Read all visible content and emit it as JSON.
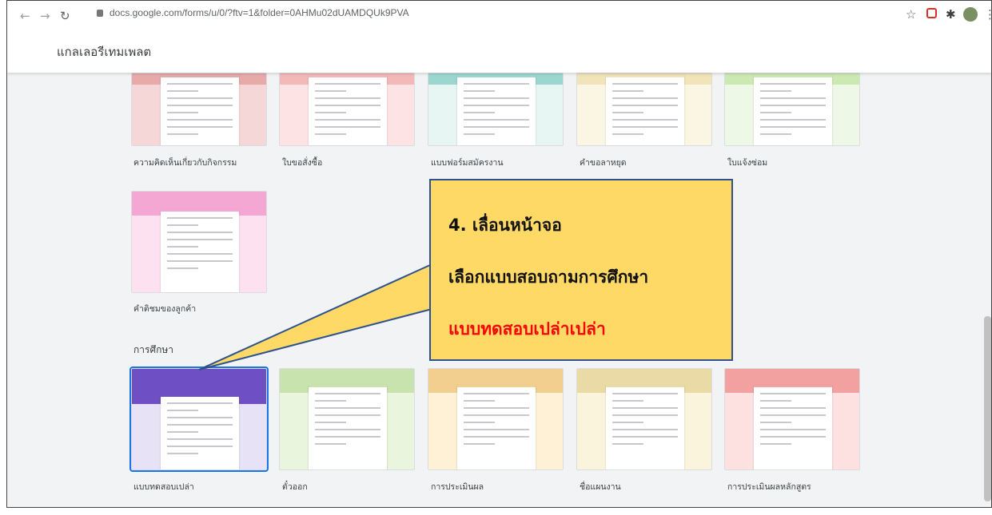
{
  "browser": {
    "url": "docs.google.com/forms/u/0/?ftv=1&folder=0AHMu02dUAMDQUk9PVA"
  },
  "header": {
    "title": "แกลเลอรีเทมเพลต"
  },
  "templates_top": [
    {
      "label": "ความคิดเห็นเกี่ยวกับกิจกรรม",
      "colors": [
        "#e8a9a9",
        "#f6d7d7"
      ]
    },
    {
      "label": "ใบขอสั่งซื้อ",
      "colors": [
        "#f3b9b9",
        "#fde3e3"
      ]
    },
    {
      "label": "แบบฟอร์มสมัครงาน",
      "colors": [
        "#9bd7cf",
        "#e7f6f3"
      ]
    },
    {
      "label": "คำขอลาหยุด",
      "colors": [
        "#f0e4b8",
        "#fbf6e3"
      ]
    },
    {
      "label": "ใบแจ้งซ่อม",
      "colors": [
        "#cce9b3",
        "#eef8e6"
      ]
    }
  ],
  "templates_middle": [
    {
      "label": "คำติชมของลูกค้า",
      "colors": [
        "#f5a7d3",
        "#fde1f0"
      ]
    }
  ],
  "education_section": {
    "title": "การศึกษา",
    "templates": [
      {
        "label": "แบบทดสอบเปล่า",
        "colors": [
          "#6f4fc4",
          "#e8e2f7"
        ]
      },
      {
        "label": "ตั๋วออก",
        "colors": [
          "#c8e3ad",
          "#e9f5dd"
        ]
      },
      {
        "label": "การประเมินผล",
        "colors": [
          "#f2cf8e",
          "#fff1d6"
        ]
      },
      {
        "label": "ชื่อแผนงาน",
        "colors": [
          "#eadba6",
          "#fbf4dc"
        ]
      },
      {
        "label": "การประเมินผลหลักสูตร",
        "colors": [
          "#f3a0a0",
          "#fde0e0"
        ]
      }
    ]
  },
  "callout": {
    "line1": "4. เลื่อนหน้าจอ",
    "line2": "เลือกแบบสอบถามการศึกษา",
    "line3": "แบบทดสอบเปล่าเปล่า",
    "fill_color": "#ffd966",
    "border_color": "#2f528f",
    "highlight_color": "#ff0000"
  },
  "icons": [
    "back-icon",
    "forward-icon",
    "reload-icon",
    "lock-icon",
    "star-icon",
    "extension-icon",
    "puzzle-icon",
    "avatar",
    "menu-icon"
  ]
}
